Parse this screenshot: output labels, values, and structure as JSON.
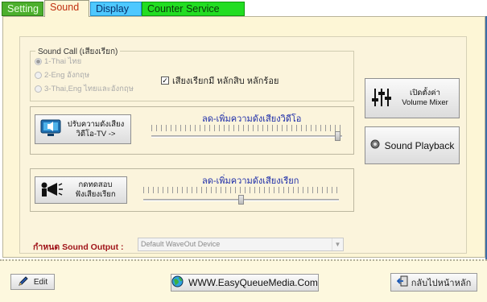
{
  "tabs": [
    "Setting",
    "Sound",
    "Display",
    "Counter Service"
  ],
  "sound_call": {
    "title": "Sound Call (เสียงเรียก)",
    "options": [
      "1-Thai ไทย",
      "2-Eng อังกฤษ",
      "3-Thai,Eng ไทยและอังกฤษ"
    ],
    "selected_index": 0,
    "checkbox_label": "เสียงเรียกมี หลักสิบ หลักร้อย",
    "checkbox_checked": true
  },
  "tv_volume": {
    "button_line1": "ปรับความดังเสียง",
    "button_line2": "วิดีโอ-TV ->",
    "slider_title": "ลด-เพิ่มความดังเสียงวิดีโอ",
    "value_fraction": 0.99
  },
  "call_volume": {
    "button_line1": "กดทดสอบ",
    "button_line2": "ฟังเสียงเรียก",
    "slider_title": "ลด-เพิ่มความดังเสียงเรียก",
    "value_fraction": 0.5
  },
  "mixer_button": {
    "line1": "เปิดตั้งค่า",
    "line2": "Volume Mixer"
  },
  "playback_button": "Sound Playback",
  "sound_output": {
    "label": "กำหนด Sound Output :",
    "value": "Default WaveOut Device"
  },
  "bottom": {
    "edit": "Edit",
    "website": "WWW.EasyQueueMedia.Com",
    "back": "กลับไปหน้าหลัก"
  }
}
